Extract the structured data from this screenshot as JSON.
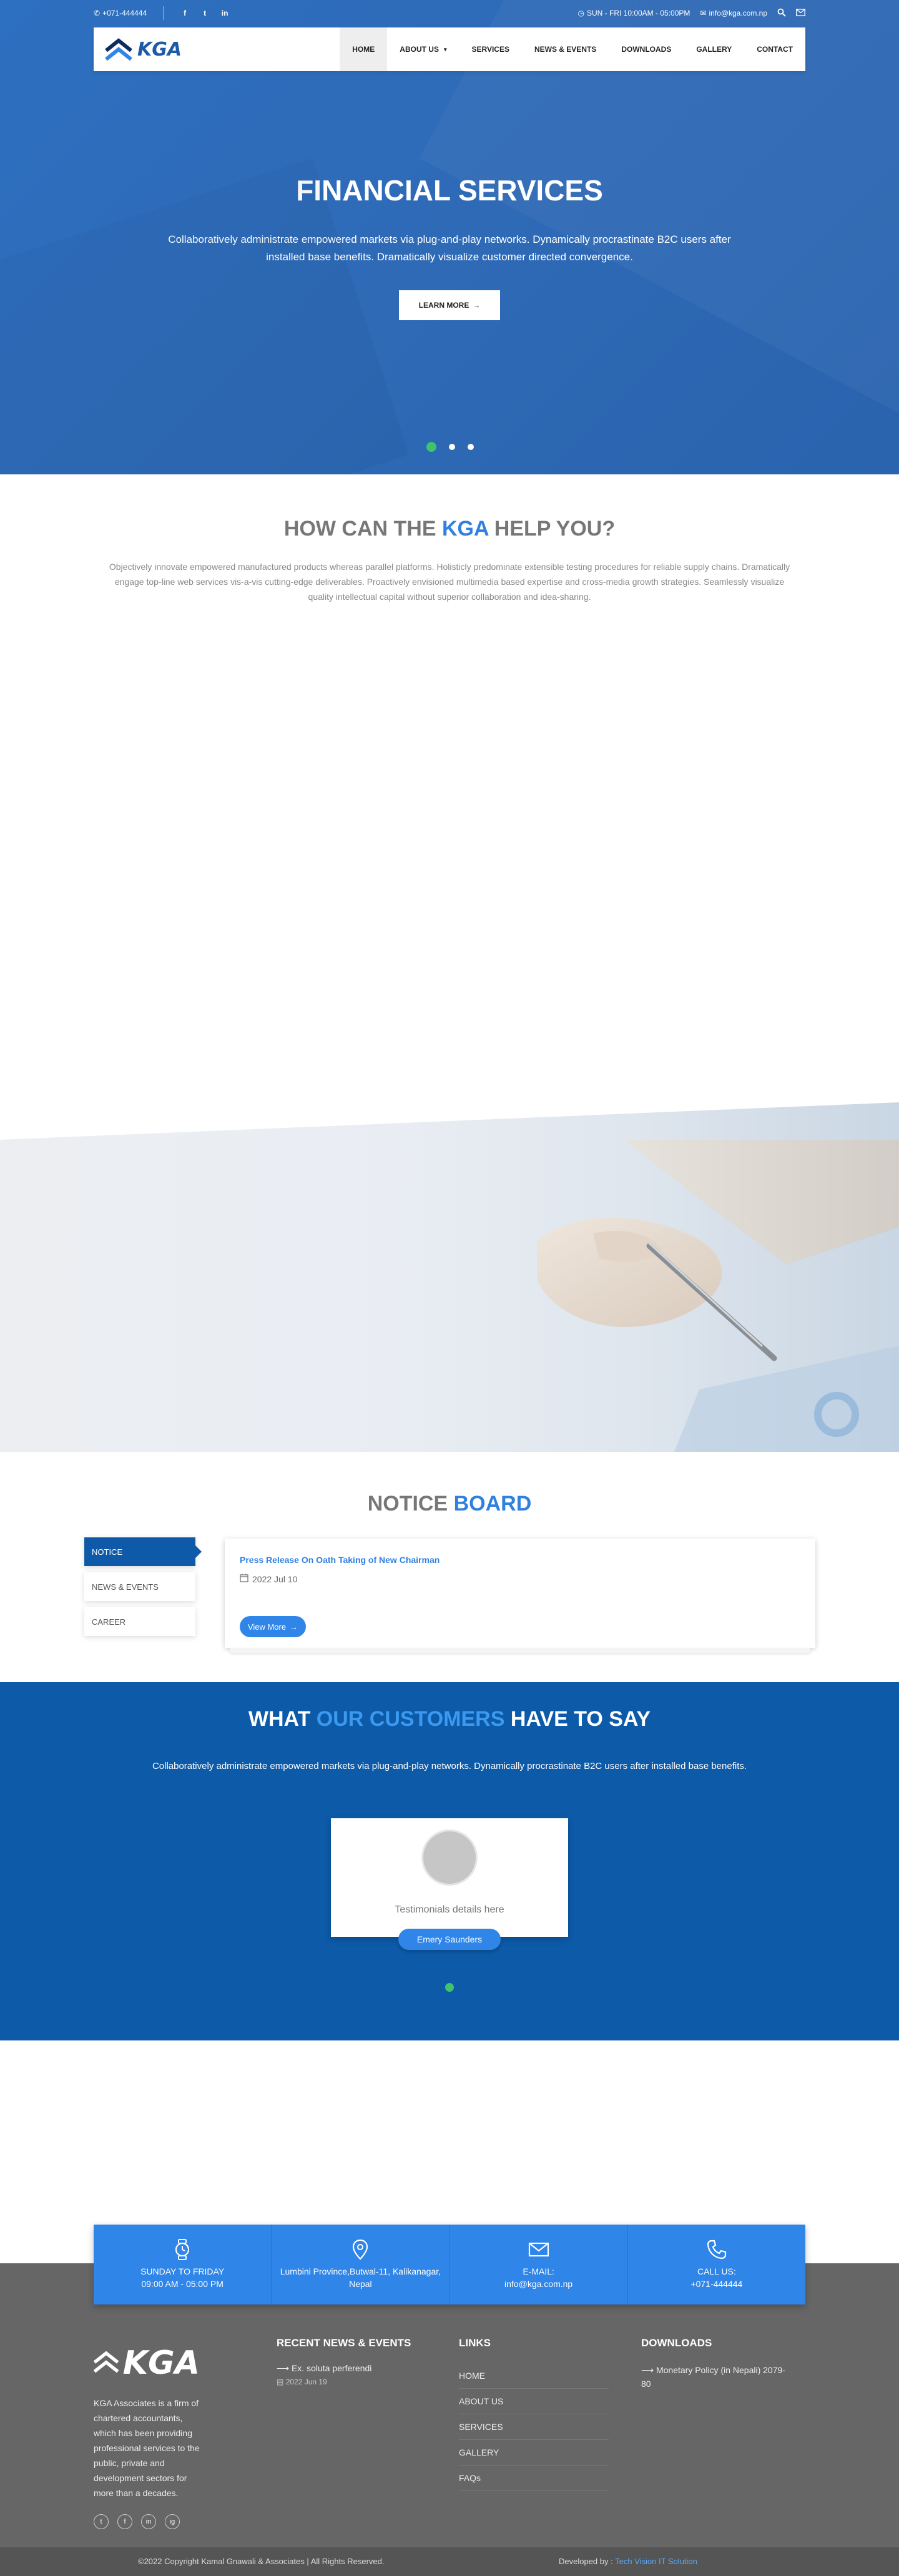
{
  "topbar": {
    "phone": "+071-444444",
    "social": [
      "f",
      "t",
      "in"
    ],
    "hours": "SUN - FRI 10:00AM - 05:00PM",
    "email": "info@kga.com.np"
  },
  "logo": {
    "text": "KGA"
  },
  "nav": {
    "items": [
      {
        "label": "HOME"
      },
      {
        "label": "ABOUT US"
      },
      {
        "label": "SERVICES"
      },
      {
        "label": "NEWS & EVENTS"
      },
      {
        "label": "DOWNLOADS"
      },
      {
        "label": "GALLERY"
      },
      {
        "label": "CONTACT"
      }
    ]
  },
  "hero": {
    "title": "FINANCIAL SERVICES",
    "text": "Collaboratively administrate empowered markets via plug-and-play networks. Dynamically procrastinate B2C users after installed base benefits. Dramatically visualize customer directed convergence.",
    "button": "LEARN MORE",
    "button_arrow": "→"
  },
  "help": {
    "title_pre": "HOW CAN THE",
    "title_hl": "KGA",
    "title_post": "HELP YOU?",
    "text": "Objectively innovate empowered manufactured products whereas parallel platforms. Holisticly predominate extensible testing procedures for reliable supply chains. Dramatically engage top-line web services vis-a-vis cutting-edge deliverables. Proactively envisioned multimedia based expertise and cross-media growth strategies. Seamlessly visualize quality intellectual capital without superior collaboration and idea-sharing."
  },
  "notice": {
    "title_pre": "NOTICE",
    "title_hl": "BOARD",
    "tabs": [
      {
        "label": "NOTICE"
      },
      {
        "label": "NEWS & EVENTS"
      },
      {
        "label": "CAREER"
      }
    ],
    "card": {
      "title": "Press Release On Oath Taking of New Chairman",
      "date": "2022 Jul 10",
      "button": "View More",
      "button_arrow": "→"
    }
  },
  "testimonials": {
    "title_pre": "WHAT",
    "title_hl": "OUR CUSTOMERS",
    "title_post": "HAVE TO SAY",
    "text": "Collaboratively administrate empowered markets via plug-and-play networks. Dynamically procrastinate B2C users after installed base benefits.",
    "detail": "Testimonials details here",
    "name": "Emery Saunders"
  },
  "contact_strip": [
    {
      "icon": "watch-icon",
      "line1": "SUNDAY TO FRIDAY",
      "line2": "09:00 AM - 05:00 PM"
    },
    {
      "icon": "location-pin-icon",
      "line1": "Lumbini Province,Butwal-11, Kalikanagar,",
      "line2": "Nepal"
    },
    {
      "icon": "envelope-icon",
      "line1": "E-MAIL:",
      "line2": "info@kga.com.np"
    },
    {
      "icon": "phone-icon",
      "line1": "CALL US:",
      "line2": "+071-444444"
    }
  ],
  "footer": {
    "logo_text": "KGA",
    "about": "KGA Associates is a firm of chartered accountants, which has been providing professional services to the public, private and development sectors for more than a decades.",
    "social": [
      "t",
      "f",
      "in",
      "ig"
    ],
    "news_heading": "RECENT NEWS & EVENTS",
    "news": {
      "title": "Ex. soluta perferendi",
      "date": "2022 Jun 19"
    },
    "links_heading": "LINKS",
    "links": [
      {
        "label": "HOME"
      },
      {
        "label": "ABOUT US"
      },
      {
        "label": "SERVICES"
      },
      {
        "label": "GALLERY"
      },
      {
        "label": "FAQs"
      }
    ],
    "downloads_heading": "DOWNLOADS",
    "downloads": [
      {
        "label": "Monetary Policy (in Nepali) 2079-80"
      }
    ]
  },
  "copyright": {
    "text": "©2022 Copyright Kamal Gnawali & Associates | All Rights Reserved.",
    "dev_pre": "Developed by :",
    "dev_name": "Tech Vision IT Solution"
  },
  "colors": {
    "hero_blue": "#2d6fc0",
    "brand_blue": "#0c5aa8",
    "accent_blue": "#2f85e8",
    "active_dot": "#3ec46d",
    "footer_gray": "#666666"
  }
}
